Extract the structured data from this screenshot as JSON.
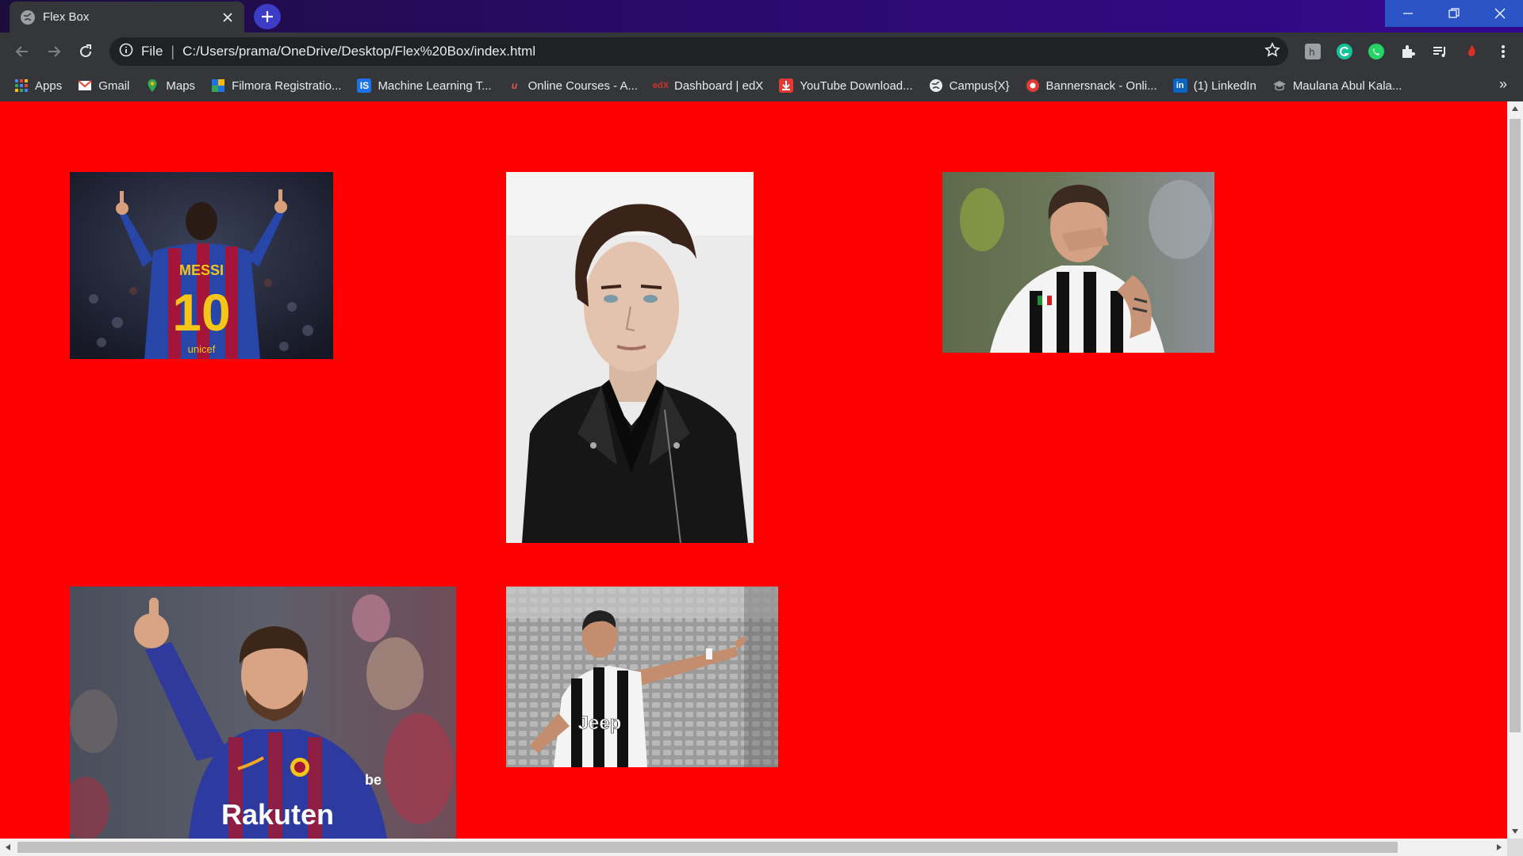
{
  "browser": {
    "tab": {
      "title": "Flex Box"
    },
    "address": {
      "scheme": "File",
      "url": "C:/Users/prama/OneDrive/Desktop/Flex%20Box/index.html"
    },
    "bookmarks": [
      {
        "label": "Apps",
        "icon": "apps-grid-icon"
      },
      {
        "label": "Gmail",
        "icon": "gmail-icon"
      },
      {
        "label": "Maps",
        "icon": "maps-pin-icon"
      },
      {
        "label": "Filmora Registratio...",
        "icon": "filmora-icon"
      },
      {
        "label": "Machine Learning T...",
        "icon": "is-icon"
      },
      {
        "label": "Online Courses - A...",
        "icon": "udemy-icon"
      },
      {
        "label": "Dashboard | edX",
        "icon": "edx-icon"
      },
      {
        "label": "YouTube Download...",
        "icon": "download-icon"
      },
      {
        "label": "Campus{X}",
        "icon": "globe-icon"
      },
      {
        "label": "Bannersnack - Onli...",
        "icon": "bannersnack-icon"
      },
      {
        "label": "(1) LinkedIn",
        "icon": "linkedin-icon"
      },
      {
        "label": "Maulana Abul Kala...",
        "icon": "graduation-cap-icon"
      }
    ],
    "more": "»"
  },
  "page": {
    "background": "#ff0000",
    "photos": [
      {
        "subject": "Messi 10 back view"
      },
      {
        "subject": "Model in leather jacket"
      },
      {
        "subject": "Dybala celebration"
      },
      {
        "subject": "Messi thumbs up"
      },
      {
        "subject": "Ronaldo pointing"
      }
    ]
  },
  "colors": {
    "accent": "#35098f",
    "toolbar": "#35363a",
    "page_bg": "#ff0000"
  }
}
